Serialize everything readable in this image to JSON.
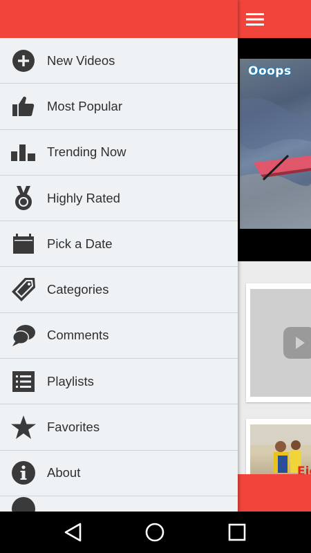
{
  "drawer": {
    "items": [
      {
        "label": "New Videos",
        "icon": "add-circle-icon"
      },
      {
        "label": "Most Popular",
        "icon": "thumbs-up-icon"
      },
      {
        "label": "Trending Now",
        "icon": "bar-chart-icon"
      },
      {
        "label": "Highly Rated",
        "icon": "medal-icon"
      },
      {
        "label": "Pick a Date",
        "icon": "calendar-icon"
      },
      {
        "label": "Categories",
        "icon": "tag-icon"
      },
      {
        "label": "Comments",
        "icon": "chat-bubbles-icon"
      },
      {
        "label": "Playlists",
        "icon": "list-icon"
      },
      {
        "label": "Favorites",
        "icon": "star-icon"
      },
      {
        "label": "About",
        "icon": "info-icon"
      }
    ]
  },
  "main": {
    "video_overlay_text": "Ooops",
    "card2_text": "Eic"
  },
  "colors": {
    "accent": "#f1453b",
    "drawer_bg": "#eff2f5",
    "icon": "#3a3a3a"
  }
}
